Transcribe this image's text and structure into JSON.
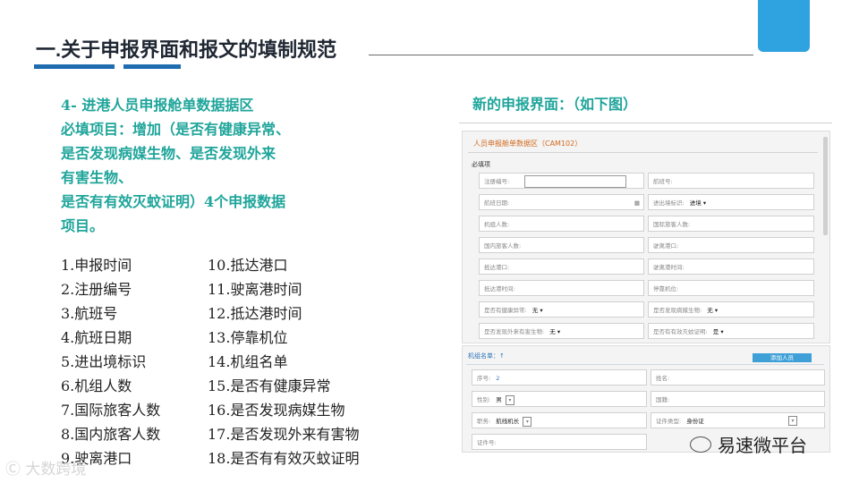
{
  "slide": {
    "title": "一.关于申报界面和报文的填制规范"
  },
  "requirements": {
    "lines": [
      "4-  进港人员申报舱单数据据区",
      "必填项目：增加（是否有健康异常、",
      "是否发现病媒生物、是否发现外来",
      "有害生物、",
      "是否有有效灭蚊证明）4个申报数据",
      "项目。"
    ]
  },
  "list_left": [
    "1.申报时间",
    "2.注册编号",
    "3.航班号",
    "4.航班日期",
    "5.进出境标识",
    "6.机组人数",
    "7.国际旅客人数",
    "8.国内旅客人数",
    "9.驶离港口"
  ],
  "list_right": [
    "10.抵达港口",
    "11.驶离港时间",
    "12.抵达港时间",
    "13.停靠机位",
    "14.机组名单",
    "15.是否有健康异常",
    "16.是否发现病媒生物",
    "17.是否发现外来有害物",
    "18.是否有有效灭蚊证明"
  ],
  "new_form_title": "新的申报界面：（如下图）",
  "form": {
    "header": "人员申报舱单数据区（CAM102）",
    "section": "必填项",
    "rows": [
      {
        "left": "注册编号:",
        "right": "航班号:"
      },
      {
        "left": "航班日期:",
        "right": "进出境标识:",
        "right_value": "进境 ▾"
      },
      {
        "left": "机组人数:",
        "right": "国际旅客人数:"
      },
      {
        "left": "国内旅客人数:",
        "right": "驶离港口:"
      },
      {
        "left": "抵达港口:",
        "right": "驶离港时间:"
      },
      {
        "left": "抵达港时间:",
        "right": "停靠机位:"
      },
      {
        "left": "是否有健康异常:",
        "left_value": "无 ▾",
        "right": "是否发现病媒生物:",
        "right_value": "无 ▾"
      },
      {
        "left": "是否发现外来有害生物:",
        "left_value": "无 ▾",
        "right": "是否有有效灭蚊证明:",
        "right_value": "是 ▾"
      }
    ]
  },
  "crew": {
    "title": "机组名单：↑",
    "add_button": "添加人员",
    "seq_label": "序号:",
    "seq_value": "2",
    "name_label": "姓名:",
    "gender_label": "性别:",
    "gender_value": "男",
    "nationality_label": "国籍:",
    "duty_label": "职务:",
    "duty_value": "航线机长",
    "id_type_label": "证件类型:",
    "id_type_value": "身份证",
    "id_no_label": "证件号:"
  },
  "brand": {
    "text": "易速微平台"
  },
  "watermark": {
    "text": "Ⓒ 大数跨境"
  }
}
